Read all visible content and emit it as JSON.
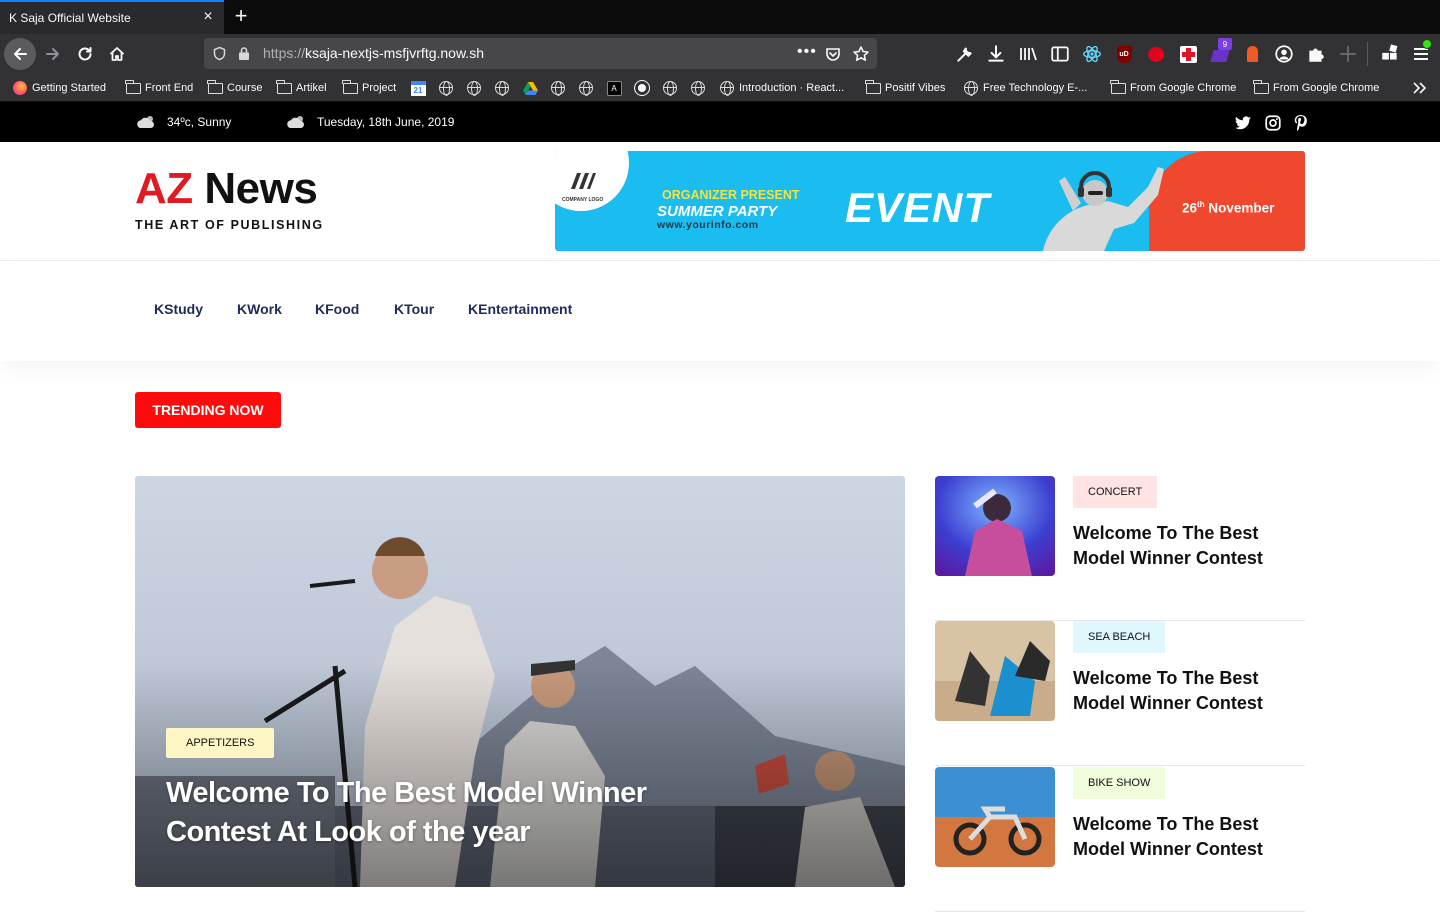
{
  "browser": {
    "tab_title": "K Saja Official Website",
    "url_protocol": "https://",
    "url_host": "ksaja-nextjs-msfjvrftg.now.sh",
    "bookmarks": [
      {
        "label": "Getting Started",
        "icon": "firefox-icon"
      },
      {
        "label": "Front End",
        "icon": "folder-icon"
      },
      {
        "label": "Course",
        "icon": "folder-icon"
      },
      {
        "label": "Artikel",
        "icon": "folder-icon"
      },
      {
        "label": "Project",
        "icon": "folder-icon"
      },
      {
        "label": "Introduction · React...",
        "icon": "globe-icon"
      },
      {
        "label": "Positif Vibes",
        "icon": "folder-icon"
      },
      {
        "label": "Free Technology E-...",
        "icon": "globe-icon"
      },
      {
        "label": "From Google Chrome",
        "icon": "folder-icon"
      },
      {
        "label": "From Google Chrome",
        "icon": "folder-icon"
      }
    ],
    "calendar_badge": "21",
    "extension_badge": "9",
    "colors": {
      "accent": "#0a84ff",
      "chrome": "#323234",
      "tabbar": "#0c0c0d"
    }
  },
  "topbar": {
    "weather": "34ºc, Sunny",
    "date": "Tuesday, 18th June, 2019",
    "social": [
      "twitter-icon",
      "instagram-icon",
      "pinterest-icon"
    ]
  },
  "header": {
    "logo_az": "AZ",
    "logo_news": "News",
    "logo_tagline": "THE ART OF PUBLISHING",
    "banner": {
      "company": "COMPANY LOGO",
      "organizer": "ORGANIZER PRESENT",
      "summer": "SUMMER PARTY",
      "url": "www.yourinfo.com",
      "event": "EVENT",
      "date_day": "26",
      "date_suffix": "th",
      "date_month": " November"
    }
  },
  "menu": {
    "items": [
      "KStudy",
      "KWork",
      "KFood",
      "KTour",
      "KEntertainment"
    ]
  },
  "trending": {
    "label": "TRENDING NOW"
  },
  "hero": {
    "category": "APPETIZERS",
    "title": "Welcome To The Best Model Winner Contest At Look of the year"
  },
  "side_posts": [
    {
      "category": "CONCERT",
      "title": "Welcome To The Best Model Winner Contest",
      "badge_color": "#ffe4e3"
    },
    {
      "category": "SEA BEACH",
      "title": "Welcome To The Best Model Winner Contest",
      "badge_color": "#dff7fd"
    },
    {
      "category": "BIKE SHOW",
      "title": "Welcome To The Best Model Winner Contest",
      "badge_color": "#f1fcdc"
    }
  ],
  "colors": {
    "brand_red": "#e01a22",
    "trending_red": "#ff0b0b",
    "menu_text": "#1f2b5a",
    "hero_badge": "#fff6c6"
  }
}
